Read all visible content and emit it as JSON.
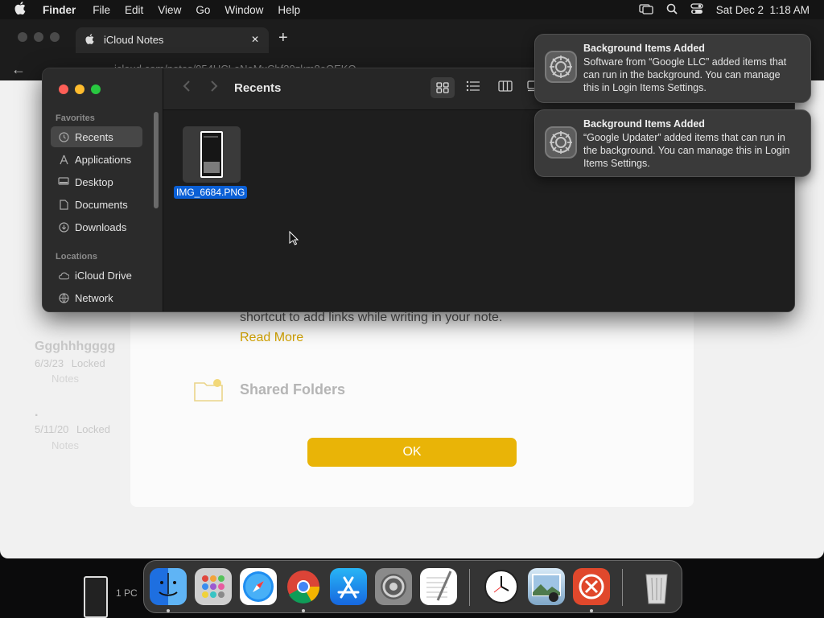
{
  "menubar": {
    "app_name": "Finder",
    "items": [
      "File",
      "Edit",
      "View",
      "Go",
      "Window",
      "Help"
    ],
    "datetime": "Sat Dec 2  1:18 AM"
  },
  "browser": {
    "tab_title": "iCloud Notes",
    "new_tab": "+",
    "close_tab": "✕",
    "address": "icloud.com/notes/054UCLeNeMxCbf30zkm8eOEKQ"
  },
  "notes_background": {
    "body_text": "shortcut to add links while writing in your note.",
    "read_more": "Read More",
    "shared_folders": "Shared Folders",
    "ok_button": "OK",
    "note_list": [
      {
        "title": "Ggghhhgggg",
        "date": "6/3/23",
        "status": "Locked",
        "folder": "Notes"
      },
      {
        "title": ".",
        "date": "5/11/20",
        "status": "Locked",
        "folder": "Notes"
      }
    ]
  },
  "finder": {
    "title": "Recents",
    "favorites_header": "Favorites",
    "locations_header": "Locations",
    "favorites": [
      {
        "label": "Recents",
        "icon": "clock-icon",
        "selected": true
      },
      {
        "label": "Applications",
        "icon": "applications-icon",
        "selected": false
      },
      {
        "label": "Desktop",
        "icon": "desktop-icon",
        "selected": false
      },
      {
        "label": "Documents",
        "icon": "document-icon",
        "selected": false
      },
      {
        "label": "Downloads",
        "icon": "download-icon",
        "selected": false
      }
    ],
    "locations": [
      {
        "label": "iCloud Drive",
        "icon": "cloud-icon"
      },
      {
        "label": "Network",
        "icon": "network-icon"
      }
    ],
    "files": [
      {
        "name": "IMG_6684.PNG",
        "selected": true
      }
    ]
  },
  "notifications": [
    {
      "title": "Background Items Added",
      "body": "Software from “Google LLC” added items that can run in the background. You can manage this in Login Items Settings."
    },
    {
      "title": "Background Items Added",
      "body": "“Google Updater” added items that can run in the background. You can manage this in Login Items Settings."
    }
  ],
  "dock": {
    "apps": [
      "Finder",
      "Launchpad",
      "Safari",
      "Google Chrome",
      "App Store",
      "System Settings",
      "TextEdit",
      "Clock",
      "Preview",
      "Microsoft Remote Desktop",
      "Trash"
    ],
    "side_label": "1 PC"
  },
  "colors": {
    "accent_yellow": "#e9b407",
    "selection_blue": "#0a5fd6"
  }
}
